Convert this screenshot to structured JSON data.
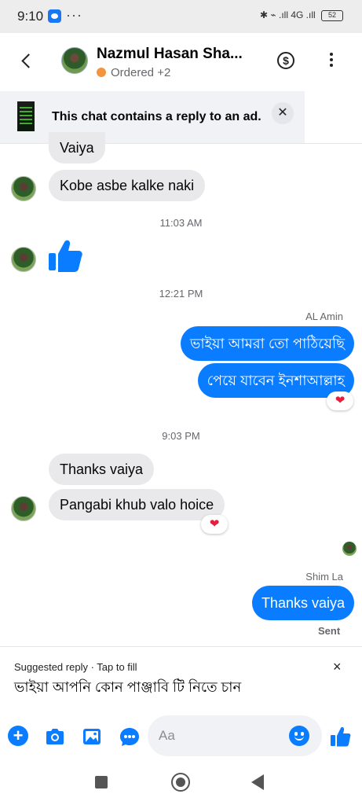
{
  "status_bar": {
    "time": "9:10",
    "dots": "···",
    "icons_text": "✱ ⌁ .ıll 4G .ıll",
    "battery": "52"
  },
  "header": {
    "contact_name": "Nazmul Hasan Sha...",
    "status_label": "Ordered",
    "status_extra": "+2",
    "status_color": "#f2953e",
    "dollar_icon_glyph": "$"
  },
  "ad_banner": {
    "text": "This chat contains a reply to an ad.",
    "close_glyph": "✕"
  },
  "messages": {
    "m1": "Vaiya",
    "m2": "Kobe asbe kalke naki",
    "ts1": "11:03 AM",
    "ts2": "12:21 PM",
    "sender1": "AL Amin",
    "m3": "ভাইয়া আমরা তো পাঠিয়েছি",
    "m4": "পেয়ে যাবেন ইনশাআল্লাহ",
    "reaction_heart": "❤",
    "ts3": "9:03 PM",
    "m5": "Thanks vaiya",
    "m6": "Pangabi khub valo hoice",
    "sender2": "Shim La",
    "m7": "Thanks vaiya",
    "sent_label": "Sent"
  },
  "suggested": {
    "header": "Suggested reply · Tap to fill",
    "text": "ভাইয়া আপনি কোন পাঞ্জাবি টি নিতে চান",
    "close_glyph": "×"
  },
  "composer": {
    "placeholder": "Aa",
    "plus_glyph": "+"
  },
  "colors": {
    "accent": "#0a7cff",
    "incoming_bubble": "#e9e9eb",
    "heart": "#e41e3f"
  }
}
